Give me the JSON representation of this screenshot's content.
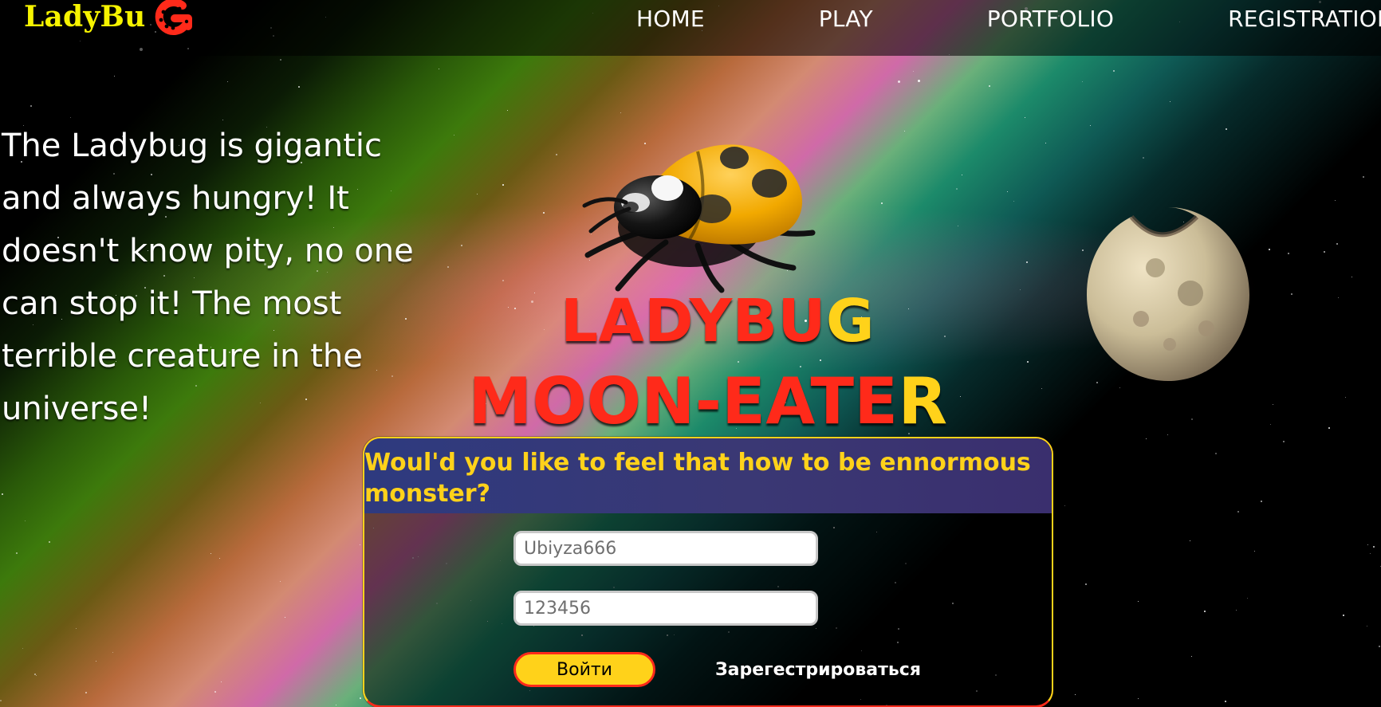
{
  "brand": {
    "name": "LadyBu",
    "logo_icon": "ladybug-g-icon",
    "colors": {
      "brand_yellow": "#f6f300",
      "brand_red": "#ff2a1a"
    }
  },
  "nav": {
    "items": [
      {
        "label": "HOME"
      },
      {
        "label": "PLAY"
      },
      {
        "label": "PORTFOLIO"
      },
      {
        "label": "REGISTRATION"
      }
    ]
  },
  "hero": {
    "intro": "The Ladybug is gigantic and always hungry! It doesn't know pity, no one can stop it! The most terrible creature in the universe!",
    "title": {
      "line1_red": "LADYBU",
      "line1_gold": "G",
      "line2_red": "MOON-EATE",
      "line2_gold": "R"
    }
  },
  "login_panel": {
    "header": "Woul'd you like to feel that how to be ennormous monster?",
    "username_placeholder": "Ubiyza666",
    "password_placeholder": "123456",
    "login_button": "Войти",
    "register_link": "Зарегестрироваться",
    "colors": {
      "header_bg": "#2e3a7f",
      "accent_yellow": "#ffd21a",
      "accent_red": "#ff2a1a"
    }
  }
}
